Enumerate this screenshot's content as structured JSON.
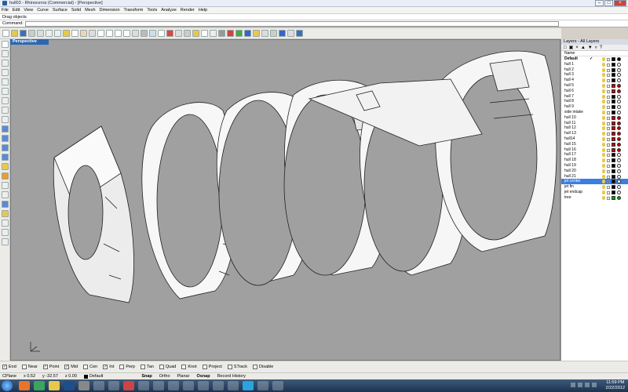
{
  "window": {
    "title": "hull03 - Rhinoceros (Commercial) - [Perspective]"
  },
  "menu": [
    "File",
    "Edit",
    "View",
    "Curve",
    "Surface",
    "Solid",
    "Mesh",
    "Dimension",
    "Transform",
    "Tools",
    "Analyze",
    "Render",
    "Help"
  ],
  "command": {
    "history": "Drag objects",
    "prompt": "Command:",
    "value": ""
  },
  "viewport": {
    "tab_label": "Perspective",
    "background": "#a0a0a0"
  },
  "layers_panel": {
    "title": "Layers - All Layers",
    "column_name": "Name",
    "rows": [
      {
        "name": "Default",
        "check": "✓",
        "color": "#000000",
        "current": true
      },
      {
        "name": "hull 1",
        "color": "#ffffff"
      },
      {
        "name": "hull 2",
        "color": "#ffffff"
      },
      {
        "name": "hull 3",
        "color": "#ffffff"
      },
      {
        "name": "hull 4",
        "color": "#ffffff"
      },
      {
        "name": "hull 5",
        "color": "#c00000"
      },
      {
        "name": "hull 6",
        "color": "#c00000"
      },
      {
        "name": "hull 7",
        "color": "#ffffff"
      },
      {
        "name": "hull 8",
        "color": "#ffffff"
      },
      {
        "name": "hull 9",
        "color": "#ffffff"
      },
      {
        "name": "side intake",
        "color": "#ffffff"
      },
      {
        "name": "hull 10",
        "color": "#c00000"
      },
      {
        "name": "hull 11",
        "color": "#c00000"
      },
      {
        "name": "hull 12",
        "color": "#c00000"
      },
      {
        "name": "hull 13",
        "color": "#c00000"
      },
      {
        "name": "hull14",
        "color": "#c00000"
      },
      {
        "name": "hull 15",
        "color": "#c00000"
      },
      {
        "name": "hull 16",
        "color": "#c00000"
      },
      {
        "name": "hull 17",
        "color": "#ffffff"
      },
      {
        "name": "hull 18",
        "color": "#ffffff"
      },
      {
        "name": "hull 19",
        "color": "#ffffff"
      },
      {
        "name": "hull 20",
        "color": "#ffffff"
      },
      {
        "name": "hull 21",
        "color": "#ffffff"
      },
      {
        "name": "jet center",
        "color": "#ffffff",
        "selected": true
      },
      {
        "name": "jet fin",
        "color": "#ffffff"
      },
      {
        "name": "jet endcap",
        "color": "#ffffff"
      },
      {
        "name": "tree",
        "color": "#00a000"
      }
    ]
  },
  "osnaps": [
    {
      "label": "End",
      "checked": true
    },
    {
      "label": "Near",
      "checked": false
    },
    {
      "label": "Point",
      "checked": true
    },
    {
      "label": "Mid",
      "checked": true
    },
    {
      "label": "Cen",
      "checked": false
    },
    {
      "label": "Int",
      "checked": true
    },
    {
      "label": "Perp",
      "checked": false
    },
    {
      "label": "Tan",
      "checked": false
    },
    {
      "label": "Quad",
      "checked": false
    },
    {
      "label": "Knot",
      "checked": false
    },
    {
      "label": "Project",
      "checked": false
    },
    {
      "label": "STrack",
      "checked": false
    },
    {
      "label": "Disable",
      "checked": false
    }
  ],
  "status": {
    "cplane": "CPlane",
    "x": "x 0.52",
    "y": "y -32.57",
    "z": "z 0.00",
    "layer": "Default",
    "snap": "Snap",
    "ortho": "Ortho",
    "planar": "Planar",
    "osnap": "Osnap",
    "record_history": "Record History"
  },
  "taskbar": {
    "time": "11:59 PM",
    "date": "2/22/2012"
  }
}
